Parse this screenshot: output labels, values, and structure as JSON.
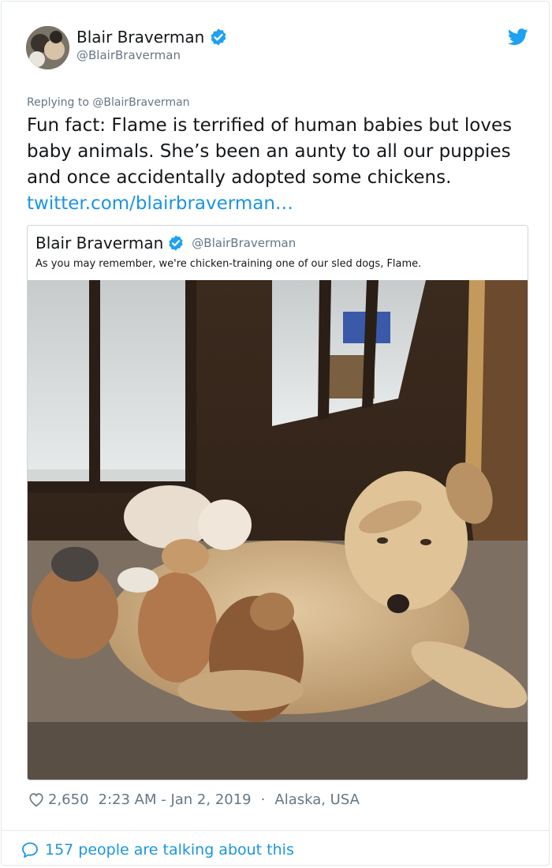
{
  "tweet": {
    "author_name": "Blair Braverman",
    "author_handle": "@BlairBraverman",
    "replying_to": "Replying to @BlairBraverman",
    "text": "Fun fact: Flame is terrified of human babies but loves baby animals. She’s been an aunty to all our puppies and once accidentally adopted some chickens.",
    "link_text": "twitter.com/blairbraverman…",
    "likes": "2,650",
    "time": "2:23 AM - Jan 2, 2019",
    "separator": "·",
    "location": "Alaska, USA",
    "talking": "157 people are talking about this"
  },
  "quote": {
    "author_name": "Blair Braverman",
    "author_handle": "@BlairBraverman",
    "text": "As you may remember, we're chicken-training one of our sled dogs, Flame."
  },
  "colors": {
    "accent_blue": "#1b95e0",
    "verified_blue": "#1da1f2",
    "secondary_text": "#657786"
  },
  "icons": [
    "avatar",
    "verified-badge-icon",
    "twitter-bird-icon",
    "heart-icon",
    "speech-bubble-icon"
  ]
}
